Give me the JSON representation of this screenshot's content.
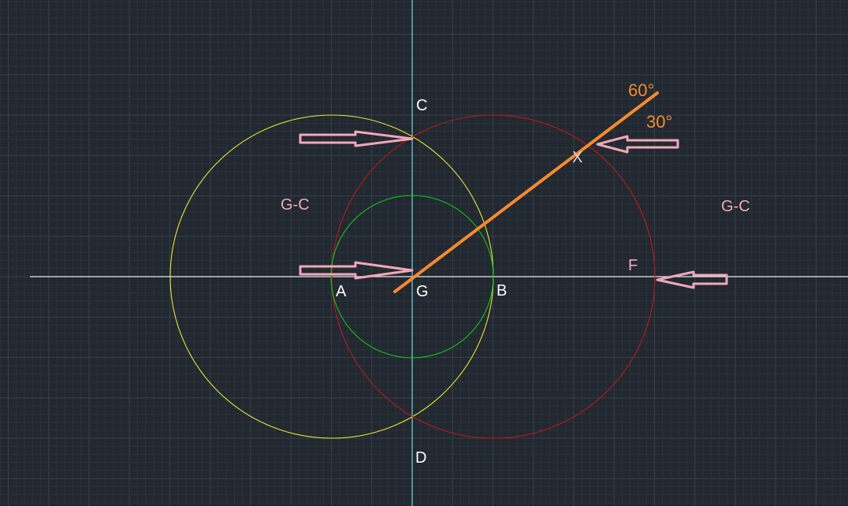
{
  "colors": {
    "background": "#212830",
    "grid_minor": "#2a323c",
    "grid_major": "#36404c",
    "horizontal_axis": "#e8e8e8",
    "vertical_axis": "#6fd6e0",
    "circle_left": "#e6e62e",
    "circle_right": "#c01818",
    "circle_inner": "#10c818",
    "orange_line": "#f58a2e",
    "arrow": "#f2a7b8"
  },
  "points": {
    "a": "A",
    "b": "B",
    "c": "C",
    "d": "D",
    "f": "F",
    "g": "G",
    "x": "X"
  },
  "regions": {
    "left": "G-C",
    "right": "G-C"
  },
  "angles": {
    "upper": "60°",
    "lower": "30°"
  }
}
